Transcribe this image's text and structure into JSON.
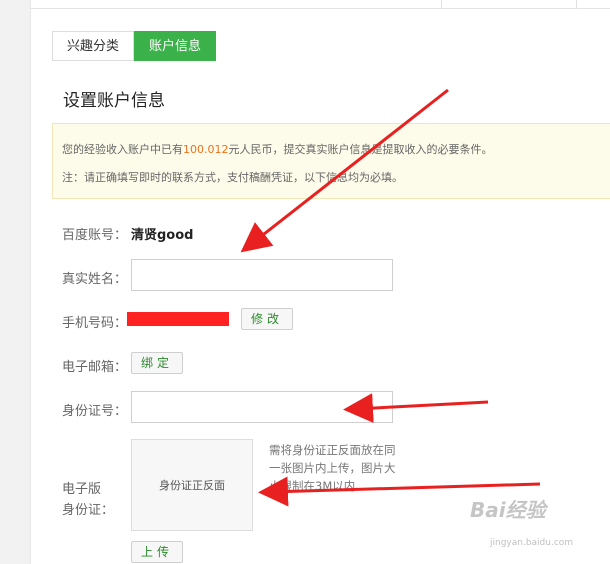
{
  "tabs": [
    {
      "label": "兴趣分类",
      "active": false
    },
    {
      "label": "账户信息",
      "active": true
    }
  ],
  "page_title": "设置账户信息",
  "notice": {
    "line1_prefix": "您的经验收入账户中已有",
    "amount": "100.012",
    "line1_suffix": "元人民币，提交真实账户信息是提取收入的必要条件。",
    "line2": "注：请正确填写即时的联系方式，支付稿酬凭证，以下信息均为必填。",
    "amount_color": "#e8731f"
  },
  "form": {
    "baidu_account_label": "百度账号：",
    "baidu_account_value": "清贤good",
    "real_name_label": "真实姓名：",
    "real_name_value": "",
    "phone_label": "手机号码：",
    "phone_modify_button": "修改",
    "email_label": "电子邮箱：",
    "email_bind_button": "绑定",
    "id_label": "身份证号：",
    "id_value": "",
    "id_image_label_1": "电子版",
    "id_image_label_2": "身份证：",
    "id_image_placeholder": "身份证正反面",
    "upload_hint": "需将身份证正反面放在同一张图片内上传，图片大小限制在3M以内",
    "upload_button": "上传"
  },
  "watermark": {
    "brand": "Bai经验",
    "url": "jingyan.baidu.com"
  },
  "colors": {
    "accent": "#3bb14a",
    "annotation_arrow": "#e82020"
  }
}
